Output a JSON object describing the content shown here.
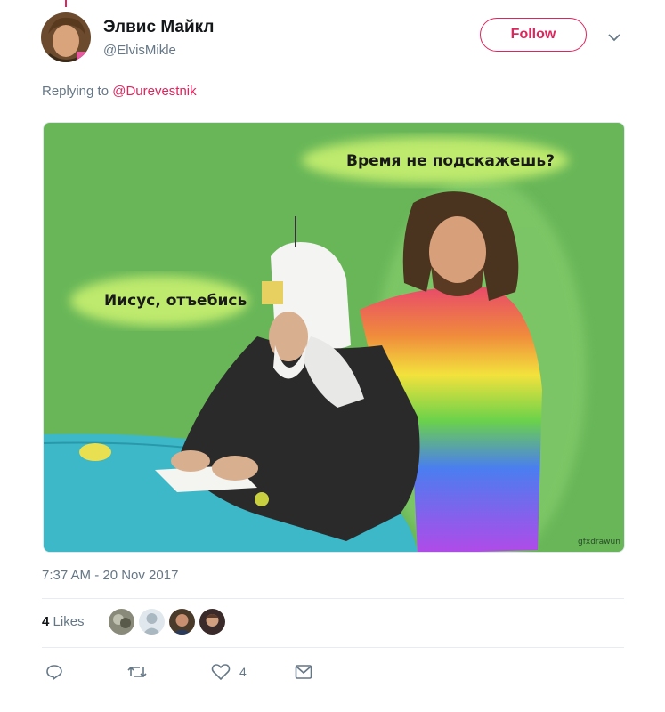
{
  "tweet": {
    "author": {
      "display_name": "Элвис Майкл",
      "handle": "@ElvisMikle"
    },
    "follow_label": "Follow",
    "replying_prefix": "Replying to",
    "replying_to": "@Durevestnik",
    "image": {
      "bubble_top": "Время не подскажешь?",
      "bubble_left": "Иисус, отъебись",
      "signature": "gfxdrawun"
    },
    "timestamp": "7:37 AM - 20 Nov 2017",
    "likes": {
      "count": "4",
      "label": "Likes"
    },
    "actions": {
      "reply_icon": "reply-icon",
      "retweet_icon": "retweet-icon",
      "like_icon": "heart-icon",
      "like_count": "4",
      "dm_icon": "envelope-icon"
    }
  },
  "colors": {
    "accent": "#e0245e",
    "muted": "#657786"
  }
}
